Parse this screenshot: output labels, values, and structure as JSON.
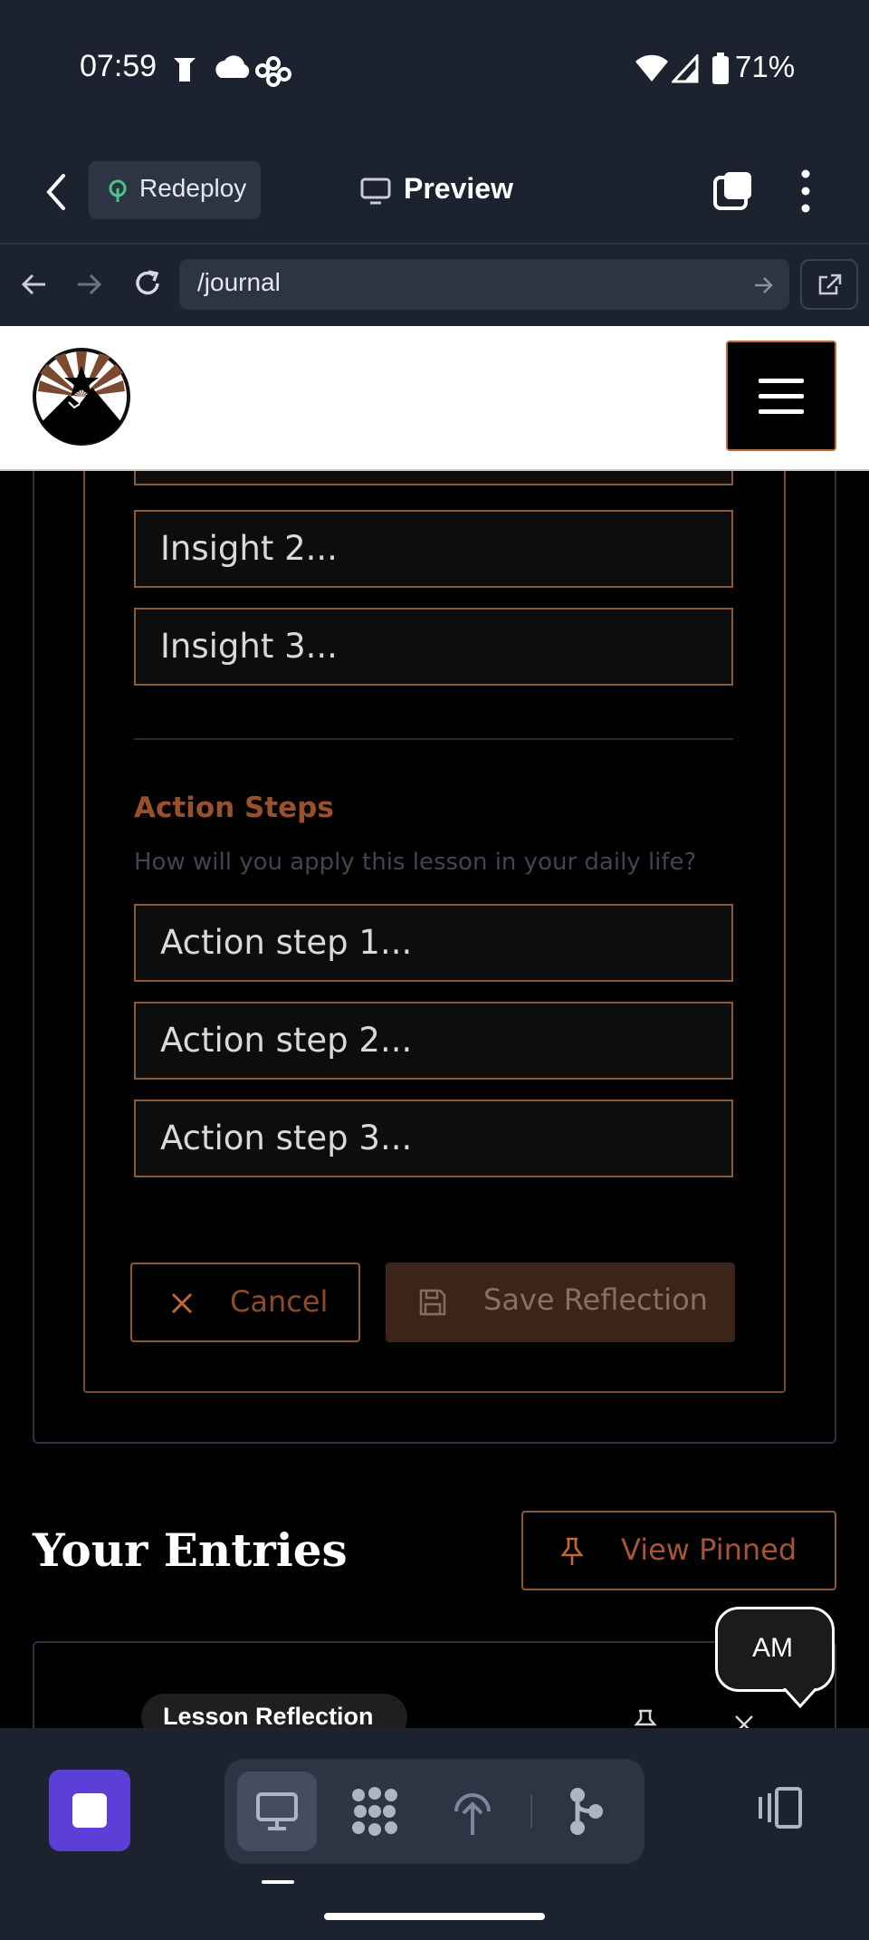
{
  "status_bar": {
    "time": "07:59",
    "battery": "71%"
  },
  "browser": {
    "redeploy_label": "Redeploy",
    "preview_label": "Preview",
    "url": "/journal"
  },
  "form": {
    "insight_placeholders": [
      "Insight 2...",
      "Insight 3..."
    ],
    "action_steps_title": "Action Steps",
    "action_steps_prompt": "How will you apply this lesson in your daily life?",
    "action_placeholders": [
      "Action step 1...",
      "Action step 2...",
      "Action step 3..."
    ],
    "cancel_label": "Cancel",
    "save_label": "Save Reflection"
  },
  "entries": {
    "title": "Your Entries",
    "view_pinned_label": "View Pinned",
    "first_entry_badge": "Lesson Reflection"
  },
  "avatar_initials": "AM",
  "colors": {
    "accent": "#c0683a",
    "accent_muted": "#8b5a38",
    "chrome_bg": "#1d2230",
    "nav_app_purple": "#5b3fd6"
  }
}
